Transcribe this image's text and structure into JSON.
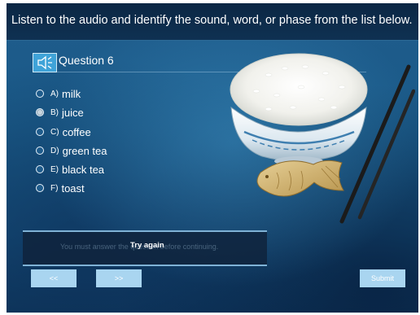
{
  "header": {
    "instruction": "Listen to the audio and identify the sound, word, or phase from the list below."
  },
  "question": {
    "title": "Question 6",
    "icon": "speaker-icon"
  },
  "options": [
    {
      "letter": "A)",
      "text": "milk",
      "selected": false
    },
    {
      "letter": "B)",
      "text": "juice",
      "selected": true
    },
    {
      "letter": "C)",
      "text": "coffee",
      "selected": false
    },
    {
      "letter": "D)",
      "text": "green tea",
      "selected": false
    },
    {
      "letter": "E)",
      "text": "black tea",
      "selected": false
    },
    {
      "letter": "F)",
      "text": "toast",
      "selected": false
    }
  ],
  "feedback": {
    "hint": "You must answer the question before continuing.",
    "message": "Try again"
  },
  "nav": {
    "prev_label": "<<",
    "next_label": ">>",
    "submit_label": "Submit"
  },
  "colors": {
    "header_bg": "#0b2744",
    "button": "#a9d5f0",
    "accent": "#3fa3d8"
  }
}
